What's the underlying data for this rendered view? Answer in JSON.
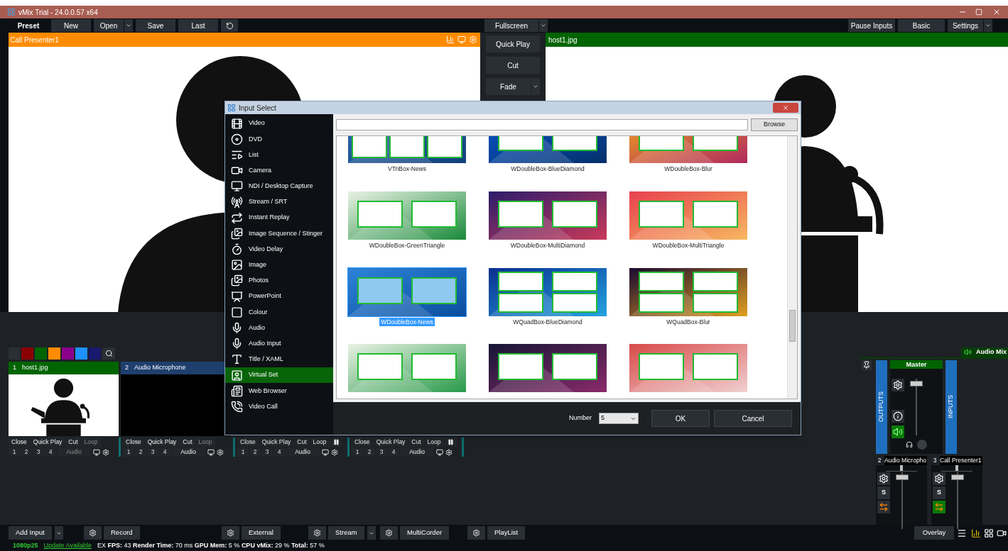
{
  "window": {
    "title": "vMix Trial - 24.0.0.57 x64"
  },
  "toolbar": {
    "left": [
      {
        "label": "Preset",
        "kind": "label"
      },
      {
        "label": "New",
        "kind": "button",
        "dropdown": false
      },
      {
        "label": "Open",
        "kind": "button",
        "dropdown": true
      },
      {
        "label": "Save",
        "kind": "button",
        "dropdown": false
      },
      {
        "label": "Last",
        "kind": "button",
        "dropdown": false
      }
    ],
    "center": {
      "label": "Fullscreen",
      "dropdown": true
    },
    "right": [
      {
        "label": "Pause Inputs",
        "dropdown": false
      },
      {
        "label": "Basic",
        "dropdown": false
      },
      {
        "label": "Settings",
        "dropdown": true
      }
    ]
  },
  "preview": {
    "title": "Call Presenter1"
  },
  "output": {
    "title": "host1.jpg"
  },
  "transitions": [
    {
      "label": "Quick Play",
      "dropdown": false
    },
    {
      "label": "Cut",
      "dropdown": false
    },
    {
      "label": "Fade",
      "dropdown": true
    }
  ],
  "colour_filters": [
    {
      "color": "#8b0000"
    },
    {
      "color": "#006400"
    },
    {
      "color": "#ff8c00"
    },
    {
      "color": "#8b008b"
    },
    {
      "color": "#1e90ff"
    },
    {
      "color": "#191970"
    }
  ],
  "inputs": [
    {
      "number": "1",
      "title": "host1.jpg",
      "color": "#006400",
      "kind": "picture"
    },
    {
      "number": "2",
      "title": "Audio Microphone",
      "color": "#1f3f6e",
      "kind": "audio"
    }
  ],
  "input_controls": [
    {
      "buttons": [
        {
          "label": "Close",
          "disabled": false
        },
        {
          "label": "Quick Play",
          "disabled": false
        },
        {
          "label": "Cut",
          "disabled": false
        },
        {
          "label": "Loop",
          "disabled": true
        }
      ],
      "pause_button": false,
      "numbers": [
        "1",
        "2",
        "3",
        "4"
      ],
      "audio": {
        "label": "Audio",
        "disabled": true
      }
    },
    {
      "buttons": [
        {
          "label": "Close",
          "disabled": false
        },
        {
          "label": "Quick Play",
          "disabled": false
        },
        {
          "label": "Cut",
          "disabled": false
        },
        {
          "label": "Loop",
          "disabled": true
        }
      ],
      "pause_button": false,
      "numbers": [
        "1",
        "2",
        "3",
        "4"
      ],
      "audio": {
        "label": "Audio",
        "disabled": false
      }
    },
    {
      "buttons": [
        {
          "label": "Close",
          "disabled": false
        },
        {
          "label": "Quick Play",
          "disabled": false
        },
        {
          "label": "Cut",
          "disabled": false
        },
        {
          "label": "Loop",
          "disabled": false
        }
      ],
      "pause_button": true,
      "numbers": [
        "1",
        "2",
        "3",
        "4"
      ],
      "audio": {
        "label": "Audio",
        "disabled": false
      }
    },
    {
      "buttons": [
        {
          "label": "Close",
          "disabled": false
        },
        {
          "label": "Quick Play",
          "disabled": false
        },
        {
          "label": "Cut",
          "disabled": false
        },
        {
          "label": "Loop",
          "disabled": false
        }
      ],
      "pause_button": true,
      "numbers": [
        "1",
        "2",
        "3",
        "4"
      ],
      "audio": {
        "label": "Audio",
        "disabled": false
      }
    }
  ],
  "dialog": {
    "title": "Input Select",
    "categories": [
      {
        "label": "Video",
        "selected": false
      },
      {
        "label": "DVD",
        "selected": false
      },
      {
        "label": "List",
        "selected": false
      },
      {
        "label": "Camera",
        "selected": false
      },
      {
        "label": "NDI / Desktop Capture",
        "selected": false
      },
      {
        "label": "Stream / SRT",
        "selected": false
      },
      {
        "label": "Instant Replay",
        "selected": false
      },
      {
        "label": "Image Sequence / Stinger",
        "selected": false
      },
      {
        "label": "Video Delay",
        "selected": false
      },
      {
        "label": "Image",
        "selected": false
      },
      {
        "label": "Photos",
        "selected": false
      },
      {
        "label": "PowerPoint",
        "selected": false
      },
      {
        "label": "Colour",
        "selected": false
      },
      {
        "label": "Audio",
        "selected": false
      },
      {
        "label": "Audio Input",
        "selected": false
      },
      {
        "label": "Title / XAML",
        "selected": false
      },
      {
        "label": "Virtual Set",
        "selected": true
      },
      {
        "label": "Web Browser",
        "selected": false
      },
      {
        "label": "Video Call",
        "selected": false
      }
    ],
    "browse_button": "Browse",
    "presets": [
      {
        "caption": "VTriBox-News",
        "selected": false
      },
      {
        "caption": "WDoubleBox-BlueDiamond",
        "selected": false
      },
      {
        "caption": "WDoubleBox-Blur",
        "selected": false
      },
      {
        "caption": "WDoubleBox-GreenTriangle",
        "selected": false
      },
      {
        "caption": "WDoubleBox-MultiDiamond",
        "selected": false
      },
      {
        "caption": "WDoubleBox-MultiTriangle",
        "selected": false
      },
      {
        "caption": "WDoubleBox-News",
        "selected": true
      },
      {
        "caption": "WQuadBox-BlueDiamond",
        "selected": false
      },
      {
        "caption": "WQuadBox-Blur",
        "selected": false
      },
      {
        "selected": false
      },
      {
        "selected": false
      },
      {
        "selected": false
      }
    ],
    "number": {
      "label": "Number",
      "value": "5"
    },
    "ok_button": "OK",
    "cancel_button": "Cancel"
  },
  "audio_mixer": {
    "tab": "Audio Mix",
    "master": {
      "label": "Master",
      "level": 0.95,
      "outputs_label": "OUTPUTS",
      "inputs_label": "INPUTS",
      "speaker_on": true
    },
    "channels": [
      {
        "number": "2",
        "name": "Audio Micropho",
        "pan": {
          "level": 0.5
        },
        "solo_label": "S",
        "level": 0.95,
        "routed": false
      },
      {
        "number": "3",
        "name": "Call Presenter1",
        "pan": {
          "level": 0.5
        },
        "solo_label": "S",
        "level": 0.95,
        "routed": true
      }
    ]
  },
  "bottom_bar": {
    "items": [
      {
        "label": "Add Input",
        "gear": false,
        "dropdown": true
      },
      {
        "label": "Record",
        "gear": true,
        "dropdown": false
      },
      {
        "label": "External",
        "gear": true,
        "dropdown": false
      },
      {
        "label": "Stream",
        "gear": true,
        "dropdown": true
      },
      {
        "label": "MultiCorder",
        "gear": true,
        "dropdown": false
      },
      {
        "label": "PlayList",
        "gear": true,
        "dropdown": false
      }
    ],
    "overlay": "Overlay"
  },
  "status_bar": {
    "format": "1080p25",
    "update": "Update Available",
    "stats": "EX **FPS:** 43 **Render Time:** 70 ms **GPU Mem:** 5 % **CPU vMix:** 29 % **Total:** 57 %"
  }
}
